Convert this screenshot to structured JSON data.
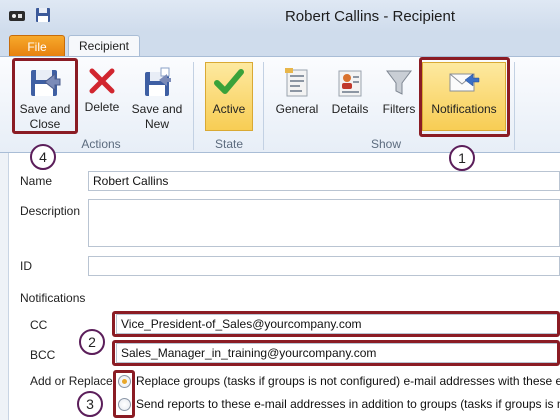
{
  "window": {
    "title": "Robert Callins - Recipient"
  },
  "tabs": {
    "file": "File",
    "recipient": "Recipient"
  },
  "ribbon": {
    "actions": {
      "save_close": [
        "Save and",
        "Close"
      ],
      "delete": "Delete",
      "save_new": [
        "Save and",
        "New"
      ],
      "group": "Actions"
    },
    "state": {
      "active": "Active",
      "group": "State"
    },
    "show": {
      "general": "General",
      "details": "Details",
      "filters": "Filters",
      "notifications": "Notifications",
      "group": "Show"
    }
  },
  "callouts": [
    "1",
    "2",
    "3",
    "4"
  ],
  "form": {
    "name_label": "Name",
    "name_value": "Robert Callins",
    "description_label": "Description",
    "description_value": "",
    "id_label": "ID",
    "id_value": "",
    "notifications_label": "Notifications",
    "cc_label": "CC",
    "cc_value": "Vice_President-of_Sales@yourcompany.com",
    "bcc_label": "BCC",
    "bcc_value": "Sales_Manager_in_training@yourcompany.com",
    "add_replace_label": "Add or Replace",
    "radio_replace": "Replace groups (tasks if groups is not configured) e-mail addresses with these e-",
    "radio_add": "Send reports to these e-mail addresses in addition to groups (tasks if groups is no",
    "radio_selected": "replace"
  },
  "colors": {
    "highlight": "#8b1c24",
    "callout_border": "#5b1e5a",
    "active_bg": "#f8cd54",
    "file_tab": "#e67f0e"
  }
}
